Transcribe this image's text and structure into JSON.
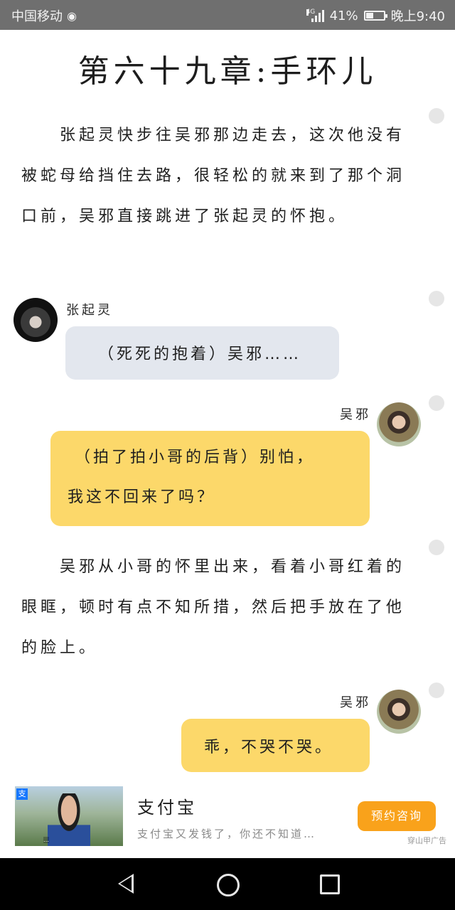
{
  "status_bar": {
    "carrier": "中国移动",
    "network": "4G",
    "battery": "41%",
    "battery_level": 0.41,
    "time": "晚上9:40"
  },
  "chapter_title": "第六十九章:手环儿",
  "narrations": [
    "张起灵快步往吴邪那边走去，这次他没有被蛇母给挡住去路，很轻松的就来到了那个洞口前，吴邪直接跳进了张起灵的怀抱。",
    "吴邪从小哥的怀里出来，看着小哥红着的眼眶，顿时有点不知所措，然后把手放在了他的脸上。"
  ],
  "messages": [
    {
      "speaker": "张起灵",
      "text": "（死死的抱着）吴邪……"
    },
    {
      "speaker": "吴邪",
      "text_line1": "（拍了拍小哥的后背）别怕，",
      "text_line2": "我这不回来了吗？"
    },
    {
      "speaker": "吴邪",
      "text": "乖，不哭不哭。"
    }
  ],
  "ad": {
    "title": "支付宝",
    "description": "支付宝又发钱了，你还不知道…",
    "button": "预约咨询",
    "label": "穿山甲广告",
    "logo_text": "支",
    "caption": "…"
  }
}
